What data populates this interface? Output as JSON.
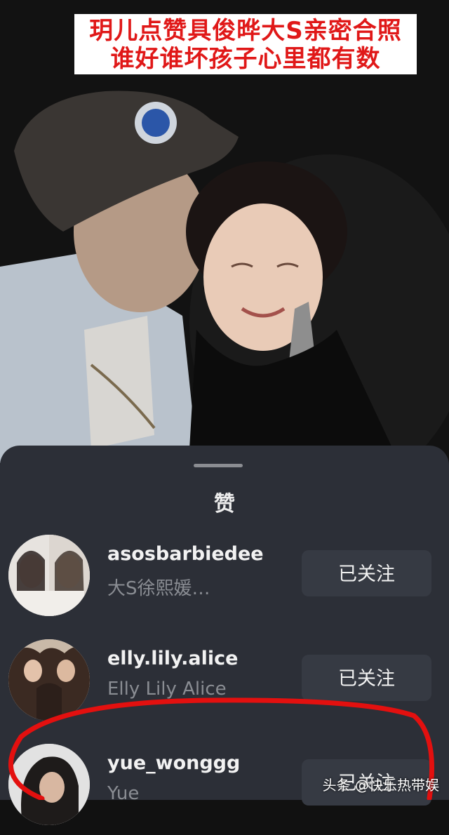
{
  "banner": {
    "line1": "玥儿点赞具俊晔大S亲密合照",
    "line2": "谁好谁坏孩子心里都有数"
  },
  "sheet": {
    "title": "赞",
    "users": [
      {
        "username": "asosbarbiedee",
        "subtitle": "大S徐熙媛…",
        "follow_label": "已关注"
      },
      {
        "username": "elly.lily.alice",
        "subtitle": "Elly Lily Alice",
        "follow_label": "已关注"
      },
      {
        "username": "yue_wonggg",
        "subtitle": "Yue",
        "follow_label": "已关注"
      }
    ]
  },
  "watermark": "头条 @快乐热带娱",
  "colors": {
    "banner_text": "#e01818",
    "sheet_bg": "#2c2f37",
    "button_bg": "#363a43",
    "annotation_circle": "#e3100f"
  }
}
